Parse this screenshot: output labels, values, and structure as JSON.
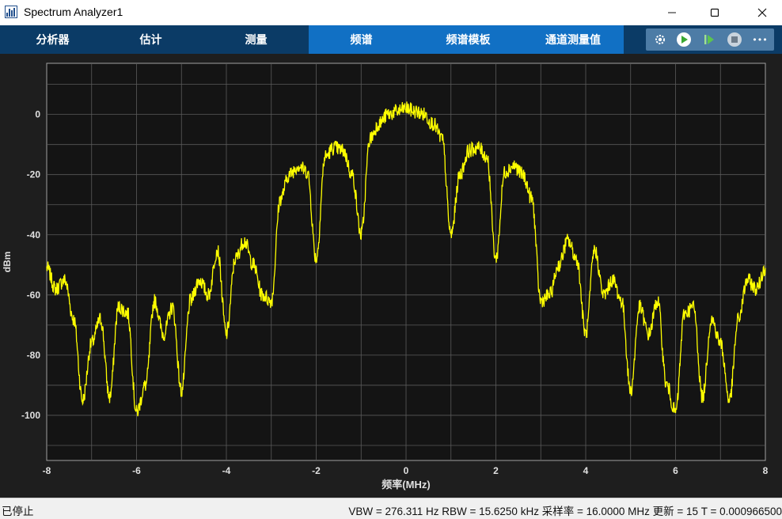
{
  "window": {
    "title": "Spectrum Analyzer1",
    "controls": [
      "minimize",
      "maximize",
      "close"
    ]
  },
  "tabs": [
    {
      "label": "分析器",
      "active": false
    },
    {
      "label": "估计",
      "active": false
    },
    {
      "label": "测量",
      "active": false
    },
    {
      "label": "频谱",
      "active": true
    },
    {
      "label": "频谱模板",
      "active": true
    },
    {
      "label": "通道测量值",
      "active": true
    }
  ],
  "toolstrip": {
    "buttons": [
      "settings-icon",
      "run-icon",
      "step-forward-icon",
      "stop-icon",
      "more-icon"
    ],
    "more_label": "•••"
  },
  "colors": {
    "trace": "#ffff00",
    "plot_bg": "#141414",
    "grid": "#5a5a5a",
    "tab_dark": "#0b3b66",
    "tab_light": "#1170c4"
  },
  "chart_data": {
    "type": "line",
    "xlabel": "频率(MHz)",
    "ylabel": "dBm",
    "xlim": [
      -8,
      8
    ],
    "ylim": [
      -115,
      17
    ],
    "xticks": [
      "-8",
      "-6",
      "-4",
      "-2",
      "0",
      "2",
      "4",
      "6",
      "8"
    ],
    "xtick_values": [
      -8,
      -6,
      -4,
      -2,
      0,
      2,
      4,
      6,
      8
    ],
    "yticks": [
      "0",
      "-20",
      "-40",
      "-60",
      "-80",
      "-100"
    ],
    "ytick_values": [
      0,
      -20,
      -40,
      -60,
      -80,
      -100
    ],
    "grid": true,
    "series": [
      {
        "x": [
          -8,
          -7.8,
          -7.6,
          -7.4,
          -7.2,
          -7,
          -6.8,
          -6.6,
          -6.4,
          -6.2,
          -6,
          -5.8,
          -5.6,
          -5.4,
          -5.2,
          -5,
          -4.8,
          -4.6,
          -4.4,
          -4.2,
          -4,
          -3.8,
          -3.6,
          -3.4,
          -3.2,
          -3,
          -2.8,
          -2.6,
          -2.4,
          -2.2,
          -2,
          -1.8,
          -1.6,
          -1.4,
          -1.2,
          -1,
          -0.8,
          -0.6,
          -0.4,
          -0.2,
          0,
          0.2,
          0.4,
          0.6,
          0.8,
          1,
          1.2,
          1.4,
          1.6,
          1.8,
          2,
          2.2,
          2.4,
          2.6,
          2.8,
          3,
          3.2,
          3.4,
          3.6,
          3.8,
          4,
          4.2,
          4.4,
          4.6,
          4.8,
          5,
          5.2,
          5.4,
          5.6,
          5.8,
          6,
          6.2,
          6.4,
          6.6,
          6.8,
          7,
          7.2,
          7.4,
          7.6,
          7.8,
          8
        ],
        "y": [
          -51,
          -58,
          -55,
          -68,
          -95,
          -76,
          -68,
          -94,
          -64,
          -66,
          -99,
          -90,
          -62,
          -73,
          -64,
          -92,
          -62,
          -55,
          -60,
          -45,
          -73,
          -48,
          -42,
          -50,
          -60,
          -62,
          -28,
          -20,
          -17,
          -19,
          -48,
          -14,
          -11,
          -12,
          -20,
          -40,
          -8,
          -3,
          0,
          1,
          2,
          1,
          0,
          -3,
          -8,
          -40,
          -20,
          -12,
          -11,
          -14,
          -48,
          -19,
          -17,
          -20,
          -28,
          -62,
          -60,
          -50,
          -42,
          -48,
          -73,
          -45,
          -60,
          -55,
          -62,
          -92,
          -64,
          -73,
          -62,
          -90,
          -99,
          -66,
          -64,
          -94,
          -68,
          -76,
          -95,
          -68,
          -55,
          -58,
          -51
        ]
      }
    ]
  },
  "status": {
    "left": "已停止",
    "right": "VBW = 276.311 Hz  RBW = 15.6250 kHz  采样率 = 16.0000 MHz  更新 = 15  T = 0.000966500"
  }
}
